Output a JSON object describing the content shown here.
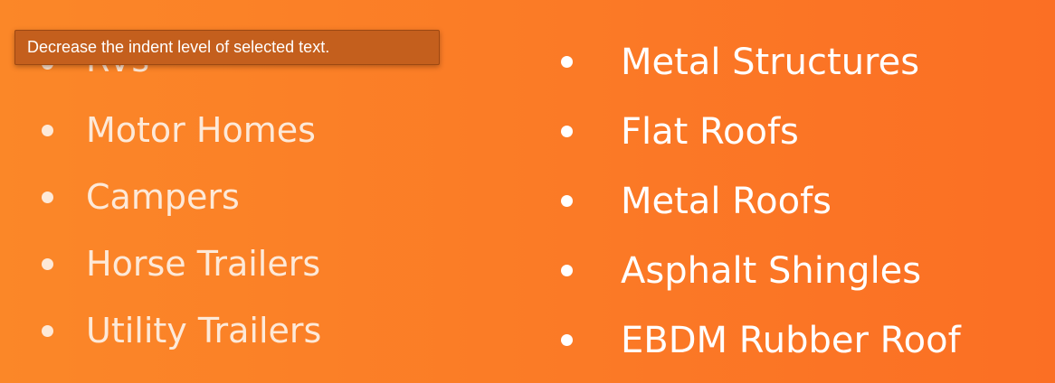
{
  "tooltip": {
    "text": "Decrease the indent level of selected text."
  },
  "lists": {
    "left": {
      "items": [
        {
          "label": "RVs"
        },
        {
          "label": "Motor Homes"
        },
        {
          "label": "Campers"
        },
        {
          "label": "Horse Trailers"
        },
        {
          "label": "Utility Trailers"
        }
      ]
    },
    "right": {
      "items": [
        {
          "label": "Metal Structures"
        },
        {
          "label": "Flat Roofs"
        },
        {
          "label": "Metal Roofs"
        },
        {
          "label": "Asphalt Shingles"
        },
        {
          "label": "EBDM Rubber Roof"
        }
      ]
    }
  },
  "colors": {
    "background_start": "#fb8728",
    "background_end": "#fb6f24",
    "left_text": "#fde9d8",
    "right_text": "#ffffff",
    "tooltip_bg": "#c45f1d"
  }
}
